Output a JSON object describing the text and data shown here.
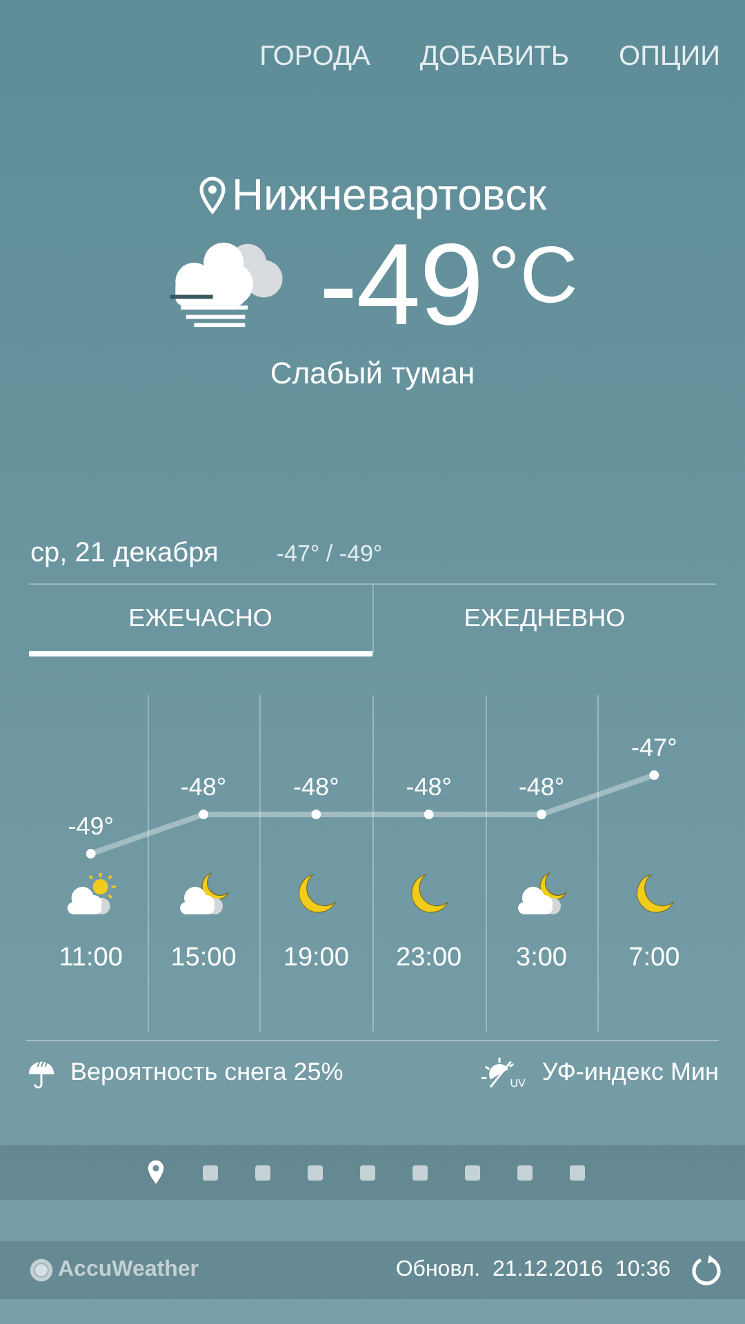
{
  "menu": [
    "ГОРОДА",
    "ДОБАВИТЬ",
    "ОПЦИИ"
  ],
  "current": {
    "city": "Нижневартовск",
    "kind": "fog",
    "temp": "-49",
    "unit": "°C",
    "condition": "Слабый туман"
  },
  "day": {
    "date": "ср, 21 декабря",
    "range": "-47° / -49°"
  },
  "tabs": [
    {
      "label": "ЕЖЕЧАСНО",
      "selected": true
    },
    {
      "label": "ЕЖЕДНЕВНО",
      "selected": false
    }
  ],
  "hourly": {
    "conditions": [
      {
        "kind": "cloud-sun"
      },
      {
        "kind": "cloud-moon"
      },
      {
        "kind": "moon"
      },
      {
        "kind": "moon"
      },
      {
        "kind": "cloud-moon"
      },
      {
        "kind": "moon"
      }
    ],
    "chart_data": {
      "type": "line",
      "categories": [
        "11:00",
        "15:00",
        "19:00",
        "23:00",
        "3:00",
        "7:00"
      ],
      "series": [
        {
          "color": "#ffffff",
          "marker": "circle",
          "values": [
            -49,
            -48,
            -48,
            -48,
            -48,
            -47
          ]
        }
      ],
      "data_labels": true
    },
    "label_suffix": "°"
  },
  "info": [
    {
      "kind": "snow",
      "text": "Вероятность снега 25%"
    },
    {
      "kind": "uv",
      "badge": "UV",
      "text": "УФ-индекс Мин"
    }
  ],
  "pages": [
    {
      "kind": "location",
      "selected": true
    },
    {
      "kind": "city",
      "selected": false
    },
    {
      "kind": "city",
      "selected": false
    },
    {
      "kind": "city",
      "selected": false
    },
    {
      "kind": "city",
      "selected": false
    },
    {
      "kind": "city",
      "selected": false
    },
    {
      "kind": "city",
      "selected": false
    },
    {
      "kind": "city",
      "selected": false
    },
    {
      "kind": "city",
      "selected": false
    }
  ],
  "footer": {
    "brand": "AccuWeather",
    "updated": "Обновл.  21.12.2016  10:36"
  }
}
